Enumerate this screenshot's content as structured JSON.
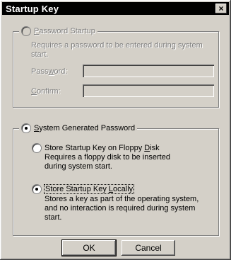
{
  "window": {
    "title": "Startup Key",
    "close_glyph": "×"
  },
  "password_group": {
    "option_label_prefix": "",
    "option_label_underlined": "P",
    "option_label_rest": "assword Startup",
    "description": "Requires a password to be entered during system start.",
    "password_label_pre": "Pass",
    "password_label_u": "w",
    "password_label_post": "ord:",
    "confirm_label_u": "C",
    "confirm_label_post": "onfirm:",
    "password_value": "",
    "confirm_value": "",
    "selected": false,
    "enabled": false
  },
  "system_group": {
    "option_label_u": "S",
    "option_label_rest": "ystem Generated Password",
    "selected": true,
    "floppy": {
      "label_pre": "Store Startup Key on Floppy ",
      "label_u": "D",
      "label_post": "isk",
      "description": "Requires a floppy disk to be inserted during system start.",
      "selected": false
    },
    "local": {
      "label_pre": "Store Startup Key ",
      "label_u": "L",
      "label_post": "ocally",
      "description": "Stores a key as part of the operating system, and no interaction is required during system start.",
      "selected": true
    }
  },
  "buttons": {
    "ok": "OK",
    "cancel": "Cancel"
  }
}
